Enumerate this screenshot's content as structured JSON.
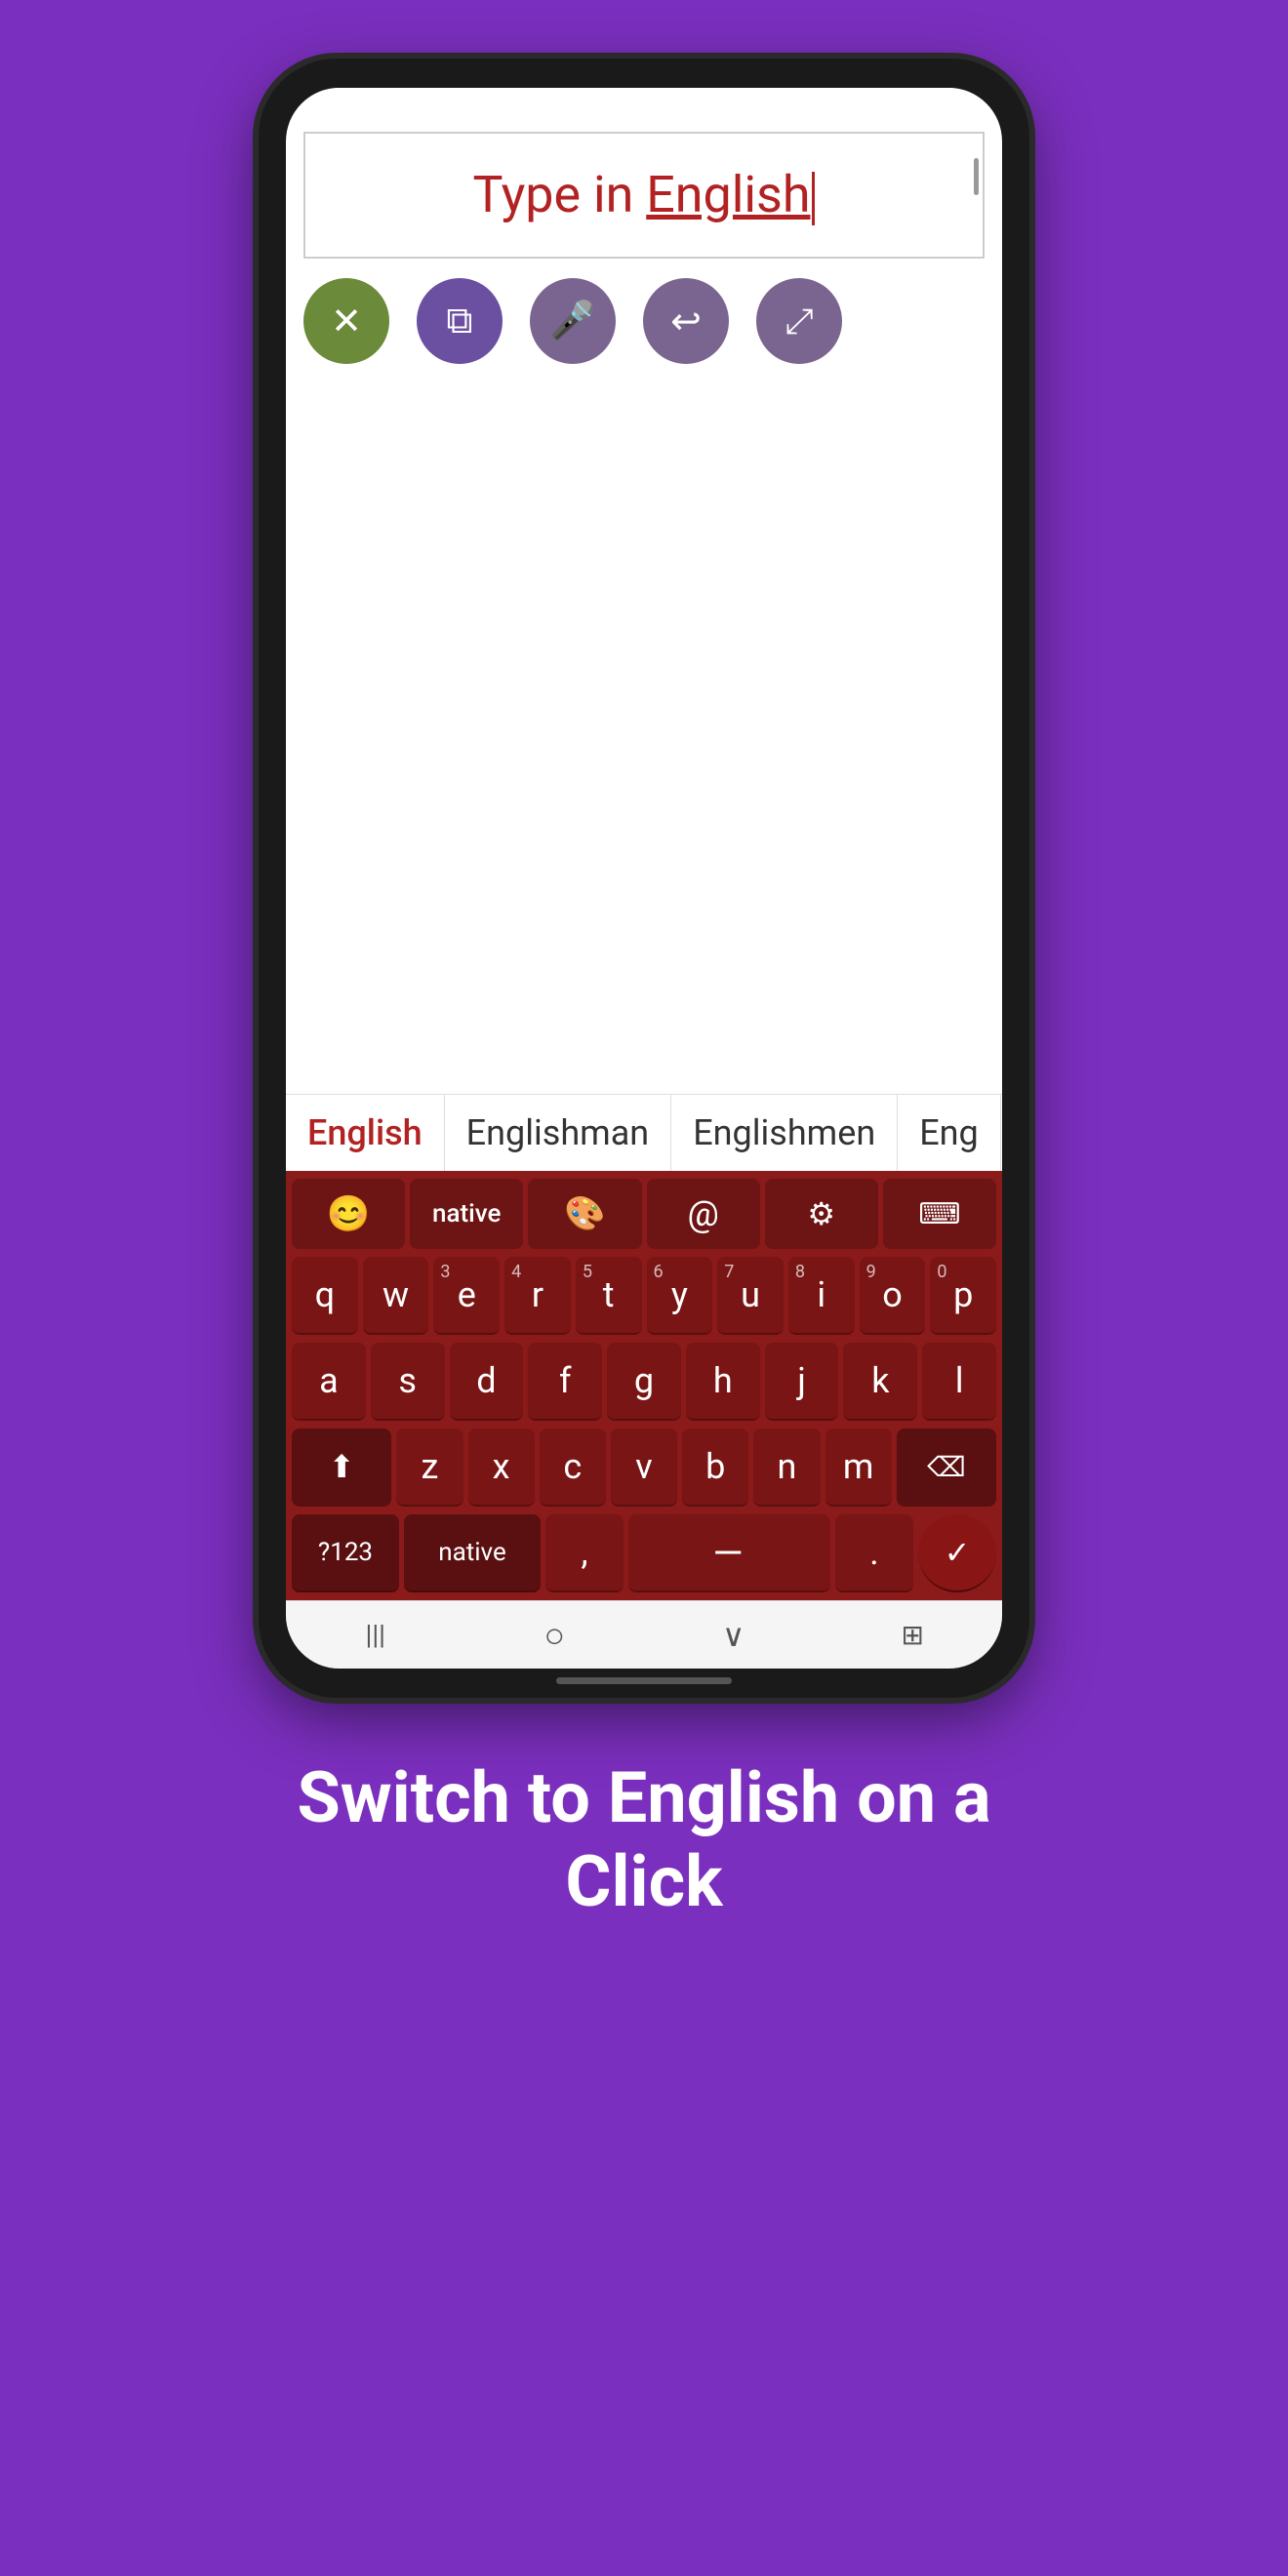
{
  "background_color": "#7B2FBE",
  "phone": {
    "text_input": {
      "content_prefix": "Type in ",
      "content_highlighted": "English",
      "has_cursor": true
    },
    "toolbar": {
      "buttons": [
        {
          "id": "delete",
          "icon": "⌫",
          "color": "#6b8a3a",
          "label": "delete"
        },
        {
          "id": "copy",
          "icon": "⧉",
          "color": "#6b4fa0",
          "label": "copy"
        },
        {
          "id": "mic",
          "icon": "🎤",
          "color": "#7a6490",
          "label": "mic"
        },
        {
          "id": "undo",
          "icon": "↩",
          "color": "#7a6490",
          "label": "undo"
        },
        {
          "id": "share",
          "icon": "⤢",
          "color": "#7a6490",
          "label": "share"
        }
      ]
    },
    "suggestions": [
      {
        "text": "English",
        "active": true
      },
      {
        "text": "Englishman",
        "active": false
      },
      {
        "text": "Englishmen",
        "active": false
      },
      {
        "text": "Eng",
        "active": false
      }
    ],
    "keyboard": {
      "special_row": [
        {
          "id": "emoji",
          "label": "😊"
        },
        {
          "id": "native",
          "label": "native"
        },
        {
          "id": "palette",
          "label": "🎨"
        },
        {
          "id": "at",
          "label": "@"
        },
        {
          "id": "settings",
          "label": "⚙"
        },
        {
          "id": "keyboard-hide",
          "label": "⌨"
        }
      ],
      "rows": [
        {
          "keys": [
            {
              "letter": "q",
              "number": ""
            },
            {
              "letter": "w",
              "number": ""
            },
            {
              "letter": "e",
              "number": "3"
            },
            {
              "letter": "r",
              "number": "4"
            },
            {
              "letter": "t",
              "number": "5"
            },
            {
              "letter": "y",
              "number": "6"
            },
            {
              "letter": "u",
              "number": "7"
            },
            {
              "letter": "i",
              "number": "8"
            },
            {
              "letter": "o",
              "number": "9"
            },
            {
              "letter": "p",
              "number": "0"
            }
          ]
        },
        {
          "keys": [
            {
              "letter": "a",
              "number": ""
            },
            {
              "letter": "s",
              "number": ""
            },
            {
              "letter": "d",
              "number": ""
            },
            {
              "letter": "f",
              "number": ""
            },
            {
              "letter": "g",
              "number": ""
            },
            {
              "letter": "h",
              "number": ""
            },
            {
              "letter": "j",
              "number": ""
            },
            {
              "letter": "k",
              "number": ""
            },
            {
              "letter": "l",
              "number": ""
            }
          ]
        },
        {
          "special_left": {
            "id": "shift",
            "icon": "⬆"
          },
          "keys": [
            {
              "letter": "z",
              "number": ""
            },
            {
              "letter": "x",
              "number": ""
            },
            {
              "letter": "c",
              "number": ""
            },
            {
              "letter": "v",
              "number": ""
            },
            {
              "letter": "b",
              "number": ""
            },
            {
              "letter": "n",
              "number": ""
            },
            {
              "letter": "m",
              "number": ""
            }
          ],
          "special_right": {
            "id": "backspace",
            "icon": "⌫"
          }
        }
      ],
      "bottom_row": {
        "num_label": "?123",
        "native_label": "native",
        "comma": ",",
        "space_icon": "▬",
        "period": ".",
        "enter_icon": "✓"
      },
      "nav_bar": {
        "back": "|||",
        "home": "○",
        "down": "∨",
        "grid": "⊞"
      }
    }
  },
  "bottom_text": {
    "line1": "Switch to English on a",
    "line2": "Click"
  }
}
